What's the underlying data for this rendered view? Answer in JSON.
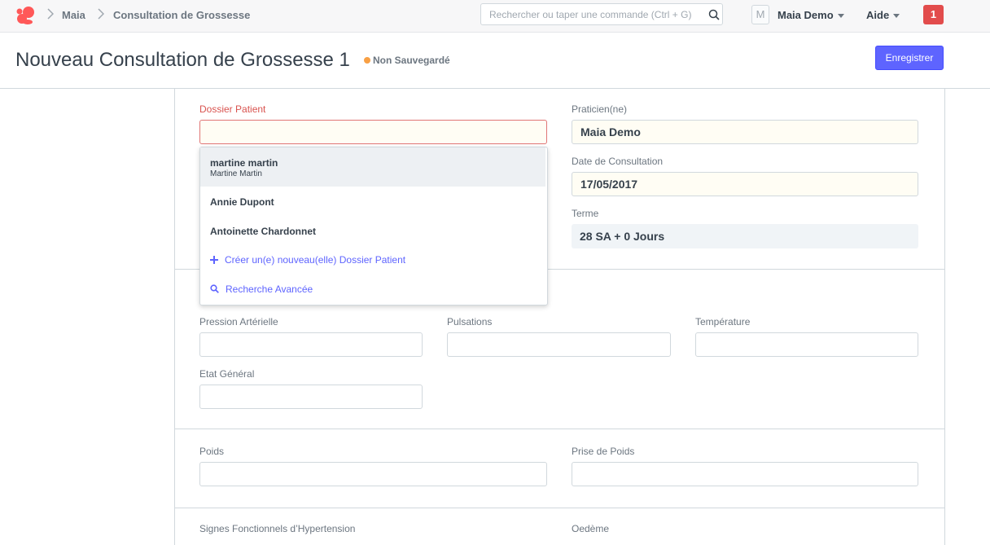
{
  "navbar": {
    "breadcrumbs": [
      "Maia",
      "Consultation de Grossesse"
    ],
    "search_placeholder": "Rechercher ou taper une commande (Ctrl + G)",
    "avatar_letter": "M",
    "user_name": "Maia Demo",
    "help_label": "Aide",
    "notification_count": "1",
    "brand_color": "#ff5858"
  },
  "page": {
    "title": "Nouveau Consultation de Grossesse 1",
    "status": "Non Sauvegardé",
    "status_color": "#f8a044",
    "save_label": "Enregistrer",
    "primary_color": "#5e64ff"
  },
  "form": {
    "dossier_patient": {
      "label": "Dossier Patient",
      "value": ""
    },
    "praticien": {
      "label": "Praticien(ne)",
      "value": "Maia Demo"
    },
    "date": {
      "label": "Date de Consultation",
      "value": "17/05/2017"
    },
    "terme": {
      "label": "Terme",
      "value": "28 SA + 0 Jours"
    },
    "pression": {
      "label": "Pression Artérielle",
      "value": ""
    },
    "pulsations": {
      "label": "Pulsations",
      "value": ""
    },
    "temperature": {
      "label": "Température",
      "value": ""
    },
    "etat_general": {
      "label": "Etat Général",
      "value": ""
    },
    "poids": {
      "label": "Poids",
      "value": ""
    },
    "prise_poids": {
      "label": "Prise de Poids",
      "value": ""
    },
    "signes_hta": {
      "label": "Signes Fonctionnels d’Hypertension"
    },
    "oedeme": {
      "label": "Oedème"
    }
  },
  "dropdown": {
    "items": [
      {
        "main": "martine martin",
        "sub": "Martine Martin"
      },
      {
        "main": "Annie Dupont"
      },
      {
        "main": "Antoinette Chardonnet"
      }
    ],
    "create_label": "Créer un(e) nouveau(elle) Dossier Patient",
    "advanced_label": "Recherche Avancée"
  }
}
